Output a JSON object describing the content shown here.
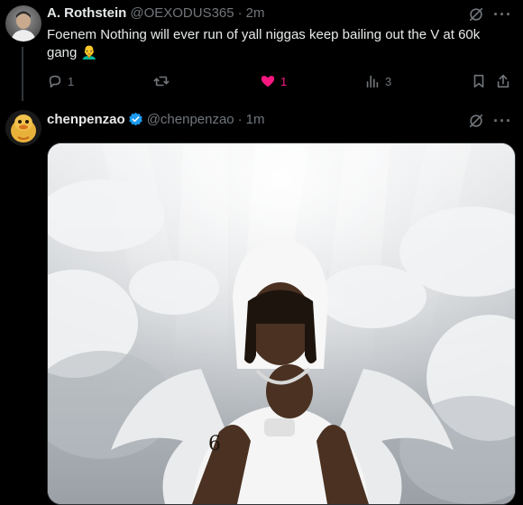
{
  "tweet1": {
    "display_name": "A. Rothstein",
    "handle": "@OEXODUS365",
    "separator": "·",
    "time": "2m",
    "text": "Foenem Nothing will ever run of yall niggas keep bailing out the V at 60k gang 👨‍🦲",
    "text_line1": "Foenem Nothing will ever run of yall niggas keep bailing out the V at 60k",
    "text_line2": "gang",
    "emoji": "👨‍🦲",
    "actions": {
      "reply_icon": "reply-icon",
      "reply_count": "1",
      "repost_icon": "repost-icon",
      "like_icon": "heart-filled-icon",
      "like_count": "1",
      "views_icon": "views-icon",
      "views_count": "3",
      "bookmark_icon": "bookmark-icon",
      "share_icon": "share-icon"
    },
    "like_color": "#f91880"
  },
  "tweet2": {
    "display_name": "chenpenzao",
    "handle": "@chenpenzao",
    "separator": "·",
    "time": "1m",
    "verified_icon": "verified-badge-icon",
    "verified_color": "#1d9bf0",
    "media": "image: man in white hooded top with angel wings and clouds, heavenly light rays"
  },
  "icons": {
    "grok": "grok-icon",
    "more": "more-icon"
  },
  "more_glyph": "···",
  "colors": {
    "background": "#000000",
    "text": "#e7e9ea",
    "muted": "#71767b",
    "divider": "#333639"
  }
}
